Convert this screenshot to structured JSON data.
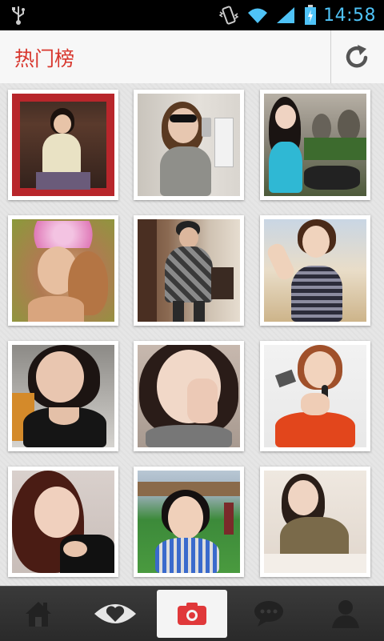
{
  "status_bar": {
    "time": "14:58"
  },
  "header": {
    "title": "热门榜"
  },
  "grid": {
    "photos": [
      {
        "id": 1
      },
      {
        "id": 2
      },
      {
        "id": 3
      },
      {
        "id": 4
      },
      {
        "id": 5
      },
      {
        "id": 6
      },
      {
        "id": 7
      },
      {
        "id": 8
      },
      {
        "id": 9
      },
      {
        "id": 10
      },
      {
        "id": 11
      },
      {
        "id": 12
      }
    ]
  },
  "tabbar": {
    "tabs": [
      {
        "icon": "home-icon"
      },
      {
        "icon": "eye-heart-icon"
      },
      {
        "icon": "camera-icon",
        "active": true
      },
      {
        "icon": "chat-bubble-icon"
      },
      {
        "icon": "person-icon"
      }
    ]
  },
  "colors": {
    "accent": "#d8372e",
    "time": "#4fc3f7",
    "tabbar": "#2f2f2f"
  }
}
